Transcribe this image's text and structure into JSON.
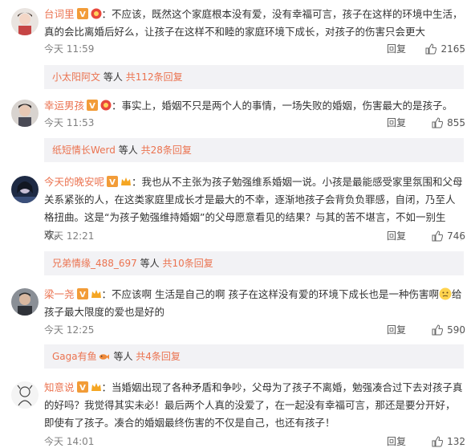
{
  "comments": [
    {
      "name": "台词里",
      "body": "：不应该，既然这个家庭根本没有爱，没有幸福可言，孩子在这样的环境中生活，真的会比离婚后好么，让孩子在这样不和睦的家庭环境下成长，对孩子的伤害只会更大",
      "time": "今天 11:59",
      "reply_label": "回复",
      "likes": "2165",
      "sub_name": "小太阳阿文",
      "sub_text": "等人",
      "sub_count": "共112条回复"
    },
    {
      "name": "幸运男孩",
      "body": "：事实上，婚姻不只是两个人的事情，一场失败的婚姻，伤害最大的是孩子。",
      "time": "今天 11:53",
      "reply_label": "回复",
      "likes": "855",
      "sub_name": "纸短情长Werd",
      "sub_text": "等人",
      "sub_count": "共28条回复"
    },
    {
      "name": "今天的晚安呢",
      "body": "：我也从不主张为孩子勉强维系婚姻一说。小孩是最能感受家里氛围和父母关系紧张的人，在这类家庭里成长才是最大的不幸，逐渐地孩子会背负负罪感，自闭，乃至人格扭曲。这是“为孩子勉强维持婚姻”的父母愿意看见的结果？与其的苦不堪言，不如一别生欢。",
      "time": "今天 12:21",
      "reply_label": "回复",
      "likes": "746",
      "sub_name": "兄弟情缘_488_697",
      "sub_text": "等人",
      "sub_count": "共10条回复"
    },
    {
      "name": "梁一尧",
      "body_a": "：不应该啊 生活是自己的啊 孩子在这样没有爱的环境下成长也是一种伤害啊",
      "body_b": "给孩子最大限度的爱也是好的",
      "time": "今天 12:25",
      "reply_label": "回复",
      "likes": "590",
      "sub_name": "Gaga有鱼",
      "sub_text": "等人",
      "sub_count": "共4条回复"
    },
    {
      "name": "知意说",
      "body": "：当婚姻出现了各种矛盾和争吵，父母为了孩子不离婚，勉强凑合过下去对孩子真的好吗？我觉得其实未必！最后两个人真的没爱了，在一起没有幸福可言，那还是要分开好，即使有了孩子。凑合的婚姻最终伤害的不仅是自己，也还有孩子！",
      "time": "今天 14:01",
      "reply_label": "回复",
      "likes": "132"
    }
  ],
  "colors": {
    "name": "#eb7350",
    "meta": "#808080",
    "subreply_bg": "#f2f2f5"
  }
}
